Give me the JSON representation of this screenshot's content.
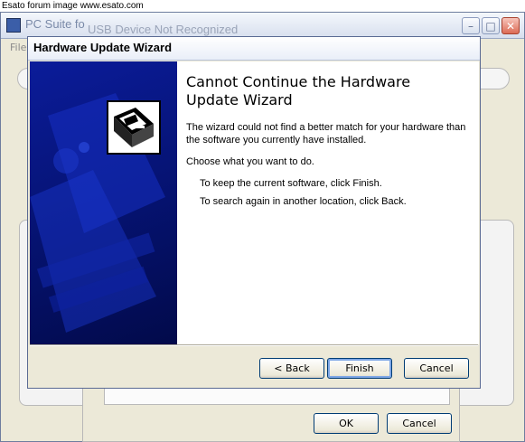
{
  "watermark": "Esato forum image www.esato.com",
  "background_window": {
    "title": "PC Suite fo",
    "overlay_title": "USB Device Not Recognized",
    "menu_file": "File",
    "controls": {
      "minimize": "–",
      "maximize": "□",
      "close": "✕"
    }
  },
  "usb_dialog": {
    "ok_label": "OK",
    "cancel_label": "Cancel"
  },
  "wizard": {
    "title": "Hardware Update Wizard",
    "heading": "Cannot Continue the Hardware Update Wizard",
    "message": "The wizard could not find a better match for your hardware than the software you currently have installed.",
    "prompt": "Choose what you want to do.",
    "option_1": "To keep the current software, click Finish.",
    "option_2": "To search again in another location, click Back.",
    "back_label": "< Back",
    "finish_label": "Finish",
    "cancel_label": "Cancel"
  }
}
